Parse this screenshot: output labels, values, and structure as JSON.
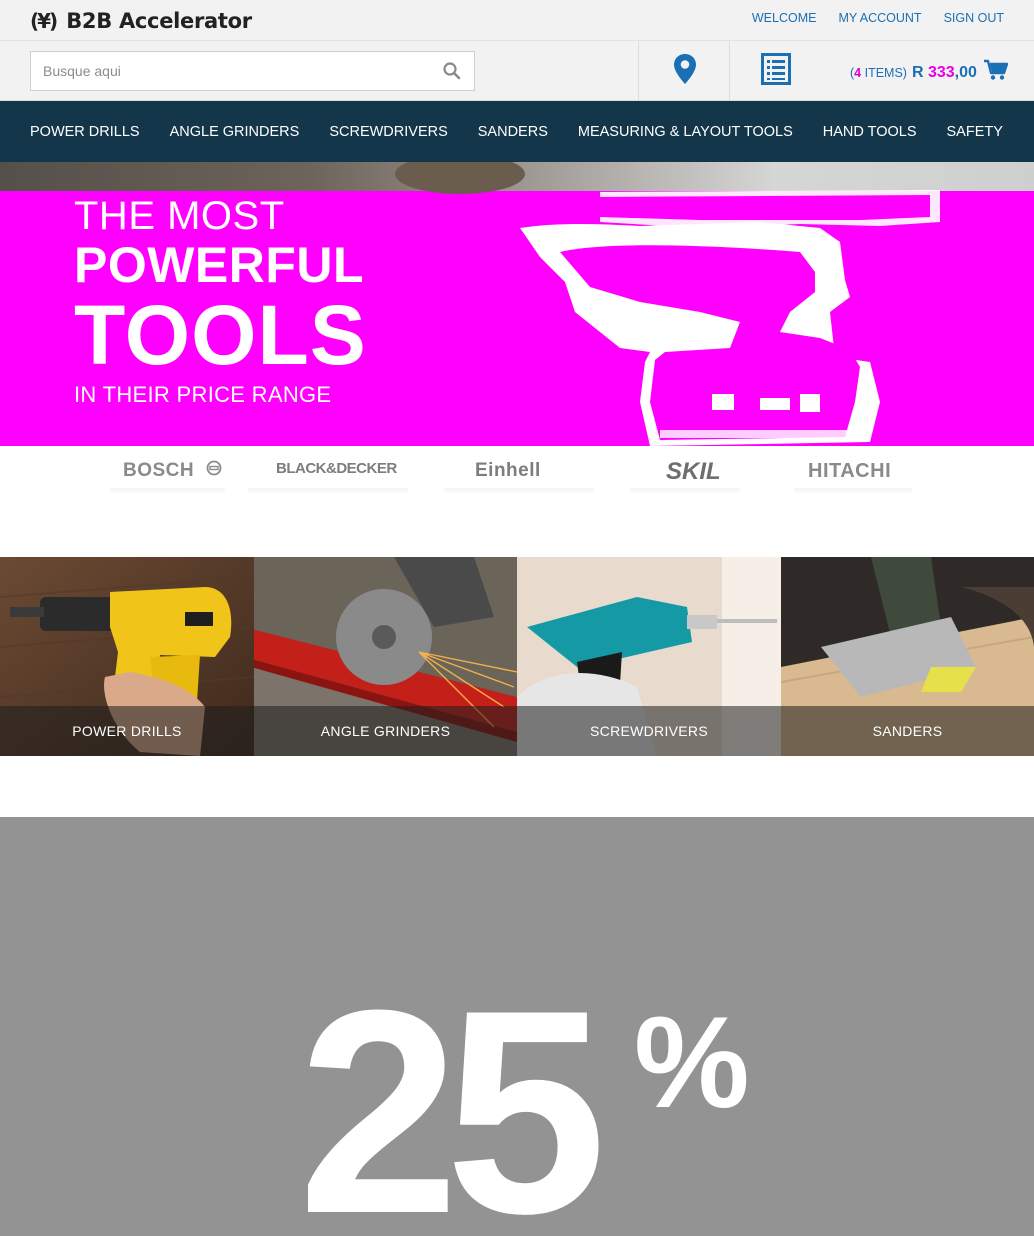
{
  "header": {
    "brand_mark": "(¥)",
    "brand_name": "B2B Accelerator",
    "links": [
      "WELCOME",
      "MY ACCOUNT",
      "SIGN OUT"
    ]
  },
  "search": {
    "placeholder": "Busque aqui",
    "value": ""
  },
  "cart": {
    "open_paren": "(",
    "count": "4",
    "items_label": " ITEMS)",
    "currency": "R ",
    "amount_hidden": "333",
    "amount_suffix": ",00"
  },
  "nav": {
    "items": [
      "POWER DRILLS",
      "ANGLE GRINDERS",
      "SCREWDRIVERS",
      "SANDERS",
      "MEASURING & LAYOUT TOOLS",
      "HAND TOOLS",
      "SAFETY"
    ]
  },
  "hero": {
    "line1": "THE MOST",
    "line2": "POWERFUL",
    "line3": "TOOLS",
    "line4": "IN THEIR PRICE RANGE"
  },
  "brands": [
    "BOSCH",
    "BLACK&DECKER",
    "Einhell",
    "SKIL",
    "HITACHI"
  ],
  "categories": [
    {
      "label": "POWER DRILLS"
    },
    {
      "label": "ANGLE GRINDERS"
    },
    {
      "label": "SCREWDRIVERS"
    },
    {
      "label": "SANDERS"
    }
  ],
  "promo": {
    "number": "25",
    "percent": "%"
  },
  "colors": {
    "nav_bg": "#14364a",
    "link_blue": "#1b6fb4",
    "hero_magenta": "#ff00ff",
    "promo_gray": "#939393"
  },
  "icons": [
    "search-icon",
    "map-pin-icon",
    "list-icon",
    "cart-icon",
    "bosch-logo-icon"
  ]
}
